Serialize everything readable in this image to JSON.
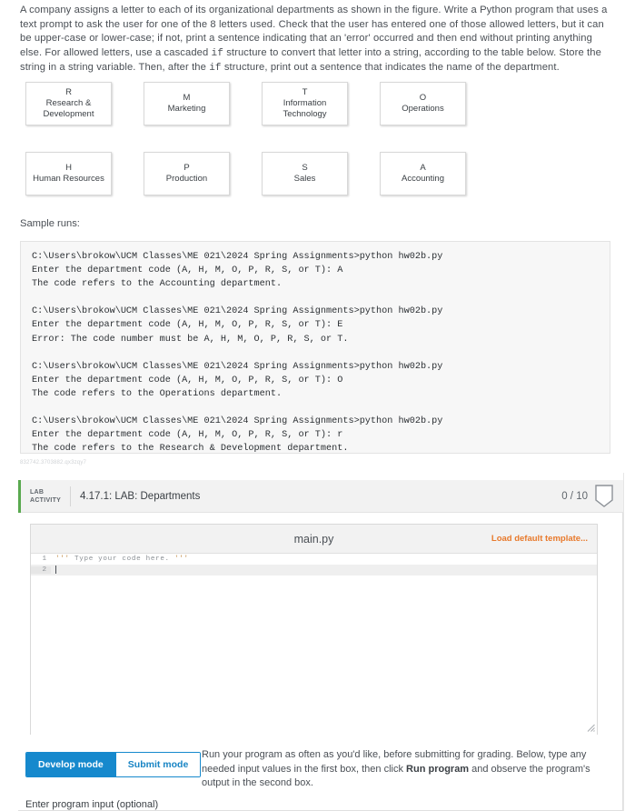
{
  "prompt": {
    "part1": "A company assigns a letter to each of its organizational departments as shown in the figure. Write a Python program that uses a text prompt to ask the user for one of the 8 letters used. Check that the user has entered one of those allowed letters, but it can be upper-case or lower-case; if not, print a sentence indicating that an 'error' occurred and then end without printing anything else. For allowed letters, use a cascaded ",
    "code1": "if",
    "part2": " structure to convert that letter into a string, according to the table below. Store the string in a string variable. Then, after the ",
    "code2": "if",
    "part3": " structure, print out a sentence that indicates the name of the department."
  },
  "departments": [
    {
      "letter": "R",
      "name": "Research & Development"
    },
    {
      "letter": "M",
      "name": "Marketing"
    },
    {
      "letter": "T",
      "name": "Information Technology"
    },
    {
      "letter": "O",
      "name": "Operations"
    },
    {
      "letter": "H",
      "name": "Human Resources"
    },
    {
      "letter": "P",
      "name": "Production"
    },
    {
      "letter": "S",
      "name": "Sales"
    },
    {
      "letter": "A",
      "name": "Accounting"
    }
  ],
  "sample_runs": {
    "label": "Sample runs:",
    "text": "C:\\Users\\brokow\\UCM Classes\\ME 021\\2024 Spring Assignments>python hw02b.py\nEnter the department code (A, H, M, O, P, R, S, or T): A\nThe code refers to the Accounting department.\n\nC:\\Users\\brokow\\UCM Classes\\ME 021\\2024 Spring Assignments>python hw02b.py\nEnter the department code (A, H, M, O, P, R, S, or T): E\nError: The code number must be A, H, M, O, P, R, S, or T.\n\nC:\\Users\\brokow\\UCM Classes\\ME 021\\2024 Spring Assignments>python hw02b.py\nEnter the department code (A, H, M, O, P, R, S, or T): O\nThe code refers to the Operations department.\n\nC:\\Users\\brokow\\UCM Classes\\ME 021\\2024 Spring Assignments>python hw02b.py\nEnter the department code (A, H, M, O, P, R, S, or T): r\nThe code refers to the Research & Development department."
  },
  "activity_id": "832742.3703882.qx3zqy7",
  "lab": {
    "tag_line1": "LAB",
    "tag_line2": "ACTIVITY",
    "title": "4.17.1: LAB: Departments",
    "score": "0 / 10"
  },
  "editor": {
    "filename": "main.py",
    "load_template": "Load default template...",
    "lines": [
      {
        "number": "1",
        "quote_open": "'''",
        "comment": " Type your code here. ",
        "quote_close": "'''"
      },
      {
        "number": "2",
        "quote_open": "",
        "comment": "",
        "quote_close": ""
      }
    ]
  },
  "modes": {
    "develop": "Develop mode",
    "submit": "Submit mode"
  },
  "help": {
    "before": "Run your program as often as you'd like, before submitting for grading. Below, type any needed input values in the first box, then click ",
    "bold": "Run program",
    "after": " and observe the program's output in the second box."
  },
  "input_label": "Enter program input (optional)",
  "colors": {
    "accent_blue": "#1689cd",
    "accent_orange": "#e8792b",
    "accent_green": "#59a94f"
  }
}
